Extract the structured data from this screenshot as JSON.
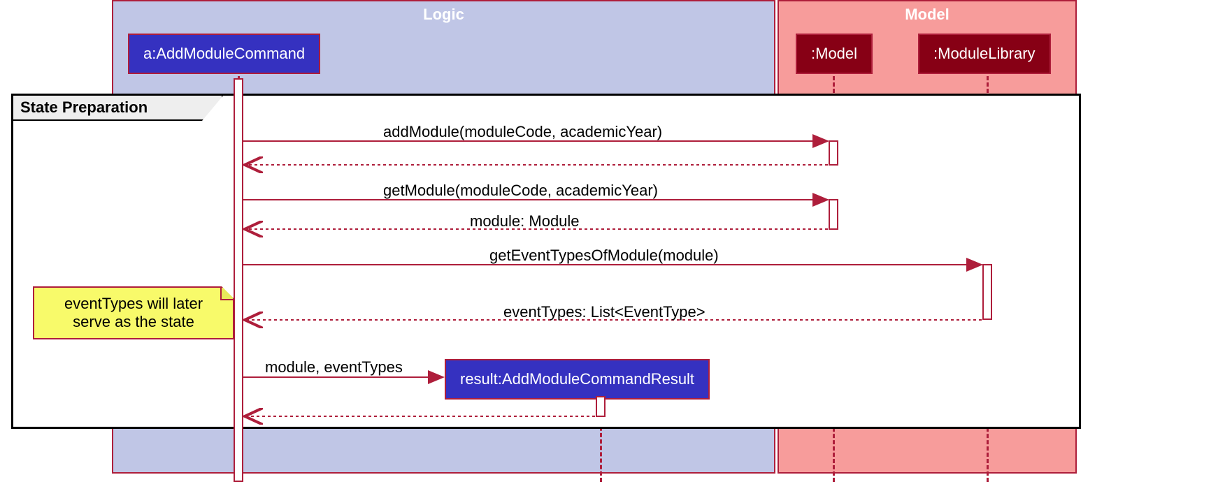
{
  "packages": {
    "logic": "Logic",
    "model": "Model"
  },
  "participants": {
    "a": "a:AddModuleCommand",
    "model": ":Model",
    "library": ":ModuleLibrary",
    "result": "result:AddModuleCommandResult"
  },
  "fragment": {
    "label": "State Preparation"
  },
  "note": {
    "line1": "eventTypes will later",
    "line2": "serve as the state"
  },
  "messages": {
    "m1": "addModule(moduleCode, academicYear)",
    "m2": "getModule(moduleCode, academicYear)",
    "m3": "module: Module",
    "m4": "getEventTypesOfModule(module)",
    "m5": "eventTypes: List<EventType>",
    "m6": "module, eventTypes"
  }
}
